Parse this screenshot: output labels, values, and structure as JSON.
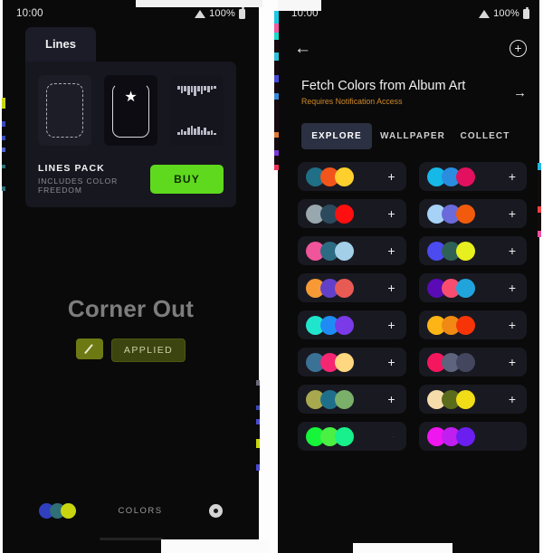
{
  "left_phone": {
    "status": {
      "time": "10:00",
      "battery": "100%",
      "wifi_icon": "wifi-icon",
      "battery_icon": "battery-icon"
    },
    "tab_label": "Lines",
    "previews": [
      {
        "name": "dashed-corner-preview"
      },
      {
        "name": "solid-corner-star-preview",
        "star_icon": "★"
      },
      {
        "name": "waveform-preview"
      }
    ],
    "pack": {
      "name": "LINES PACK",
      "subtitle": "INCLUDES COLOR FREEDOM",
      "buy_label": "BUY",
      "buy_color": "#5fd91d"
    },
    "hero": {
      "title": "Corner Out",
      "edit_icon": "pencil-icon",
      "applied_label": "APPLIED",
      "applied_color": "#3c4410"
    },
    "bottom": {
      "colors_label": "COLORS",
      "gear_icon": "gear-icon",
      "dots": [
        "#2f3fbe",
        "#2f6f77",
        "#c9d60f"
      ]
    }
  },
  "right_phone": {
    "status": {
      "time": "10:00",
      "battery": "100%",
      "wifi_icon": "wifi-icon",
      "battery_icon": "battery-icon"
    },
    "topbar": {
      "back_icon": "←",
      "add_icon": "+"
    },
    "fetch": {
      "title": "Fetch Colors from Album Art",
      "subtitle": "Requires Notification Access",
      "subtitle_color": "#d08a2a",
      "arrow_icon": "→"
    },
    "tabs": [
      {
        "label": "EXPLORE",
        "active": true
      },
      {
        "label": "WALLPAPER",
        "active": false
      },
      {
        "label": "COLLECT",
        "active": false
      }
    ],
    "add_icon": "+",
    "palettes": [
      {
        "colors": [
          "#1f6f86",
          "#f2551b",
          "#ffcf2e"
        ],
        "action": "+"
      },
      {
        "colors": [
          "#16b8e8",
          "#2a8de0",
          "#e2105e"
        ],
        "action": "+"
      },
      {
        "colors": [
          "#99a7ae",
          "#2b4a5e",
          "#ff0f10"
        ],
        "action": "+"
      },
      {
        "colors": [
          "#a7d2f7",
          "#6a6ada",
          "#f25b0c"
        ],
        "action": "+"
      },
      {
        "colors": [
          "#f0549b",
          "#2d6b83",
          "#a3cfe8"
        ],
        "action": "+"
      },
      {
        "colors": [
          "#4b4bf0",
          "#2f6156",
          "#e8ef1f"
        ],
        "action": "+"
      },
      {
        "colors": [
          "#f79a35",
          "#6340c9",
          "#e85a54"
        ],
        "action": "+"
      },
      {
        "colors": [
          "#5a0bb5",
          "#f94d70",
          "#21a4dc"
        ],
        "action": "+"
      },
      {
        "colors": [
          "#20e5cd",
          "#1f8cf5",
          "#7a3ae8"
        ],
        "action": "+"
      },
      {
        "colors": [
          "#fcb515",
          "#f08a14",
          "#f63408"
        ],
        "action": "+"
      },
      {
        "colors": [
          "#3a7196",
          "#f52672",
          "#ffd780"
        ],
        "action": "+"
      },
      {
        "colors": [
          "#f5175e",
          "#5e637e",
          "#43465e"
        ],
        "action": "+"
      },
      {
        "colors": [
          "#a8a84f",
          "#1f6f8c",
          "#7ab06a"
        ],
        "action": "+"
      },
      {
        "colors": [
          "#f5dcab",
          "#5a6b1c",
          "#f0dc17"
        ],
        "action": "+"
      },
      {
        "colors": [
          "#17f53a",
          "#4bf045",
          "#17f08c"
        ],
        "action": "·"
      },
      {
        "colors": [
          "#f016f0",
          "#c01ff0",
          "#6a1ff0"
        ],
        "action": ""
      }
    ]
  }
}
